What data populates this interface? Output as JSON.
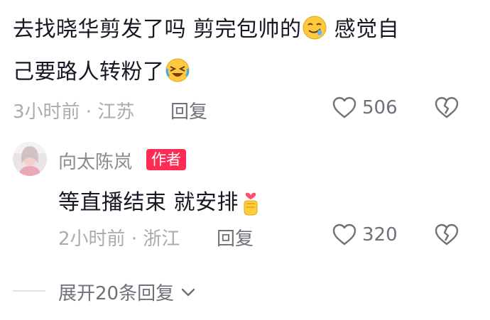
{
  "comment": {
    "line1": "去找晓华剪发了吗 剪完包帅的",
    "line1_end": " 感觉自",
    "line2": "己要路人转粉了",
    "time": "3小时前 · 江苏",
    "reply_label": "回复",
    "likes": "506"
  },
  "reply": {
    "username": "向太陈岚",
    "badge": "作者",
    "text": "等直播结束 就安排",
    "time": "2小时前 · 浙江",
    "reply_label": "回复",
    "likes": "320"
  },
  "expand": {
    "label": "展开20条回复"
  },
  "colors": {
    "text": "#161823",
    "meta": "#a9abb0",
    "badge": "#fe2c55"
  },
  "icons": [
    "drooling-smile-emoji",
    "laughing-tears-emoji",
    "heart-icon",
    "broken-heart-icon",
    "finger-heart-emoji",
    "chevron-down-icon",
    "avatar"
  ]
}
